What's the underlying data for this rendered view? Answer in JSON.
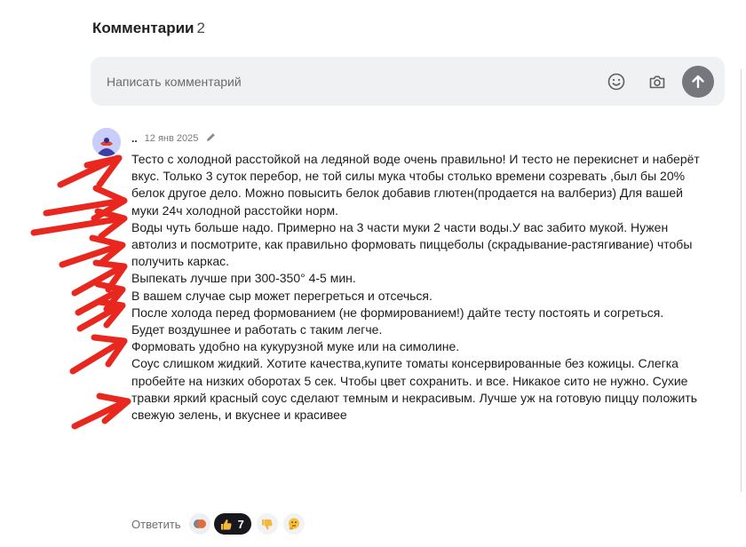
{
  "comments_section": {
    "title": "Комментарии",
    "count": "2"
  },
  "composer": {
    "placeholder": "Написать комментарий",
    "icons": [
      "smiley-icon",
      "camera-icon",
      "arrow-up-icon"
    ]
  },
  "comment": {
    "author": "..",
    "date": "12 янв 2025",
    "paragraphs": [
      "Тесто с холодной расстойкой на ледяной воде очень правильно! И тесто не перекиснет и наберёт вкус. Только 3 суток перебор, не той силы мука чтобы столько времени созревать ,был бы 20% белок другое дело. Можно повысить белок добавив глютен(продается на валбериз) Для вашей муки 24ч холодной расстойки норм.",
      "Воды чуть больше надо. Примерно на 3 части муки 2 части воды.У вас забито мукой. Нужен автолиз и посмотрите, как правильно формовать пиццеболы (скрадывание-растягивание) чтобы получить каркас.",
      "Выпекать лучше при 300-350° 4-5 мин.",
      "В вашем случае сыр может перегреться и отсечься.",
      "После холода перед формованием (не формированием!) дайте тесту постоять и согреться.",
      "Будет воздушнее и работать с таким легче.",
      "Формовать удобно на кукурузной муке или на симолине.",
      "Соус слишком жидкий. Хотите качества,купите томаты консервированные без кожицы. Слегка пробейте на низких оборотах 5 сек. Чтобы цвет сохранить. и все. Никакое сито не нужно. Сухие травки яркий красный соус сделают темным и некрасивым. Лучше уж на готовую пиццу положить свежую зелень, и вкуснее и красивее"
    ],
    "reply_label": "Ответить",
    "like_count": "7"
  },
  "colors": {
    "arrow": "#e8281f",
    "send_button": "#75777c",
    "composer_bg": "#f0f1f3",
    "like_pill": "#17181b"
  }
}
